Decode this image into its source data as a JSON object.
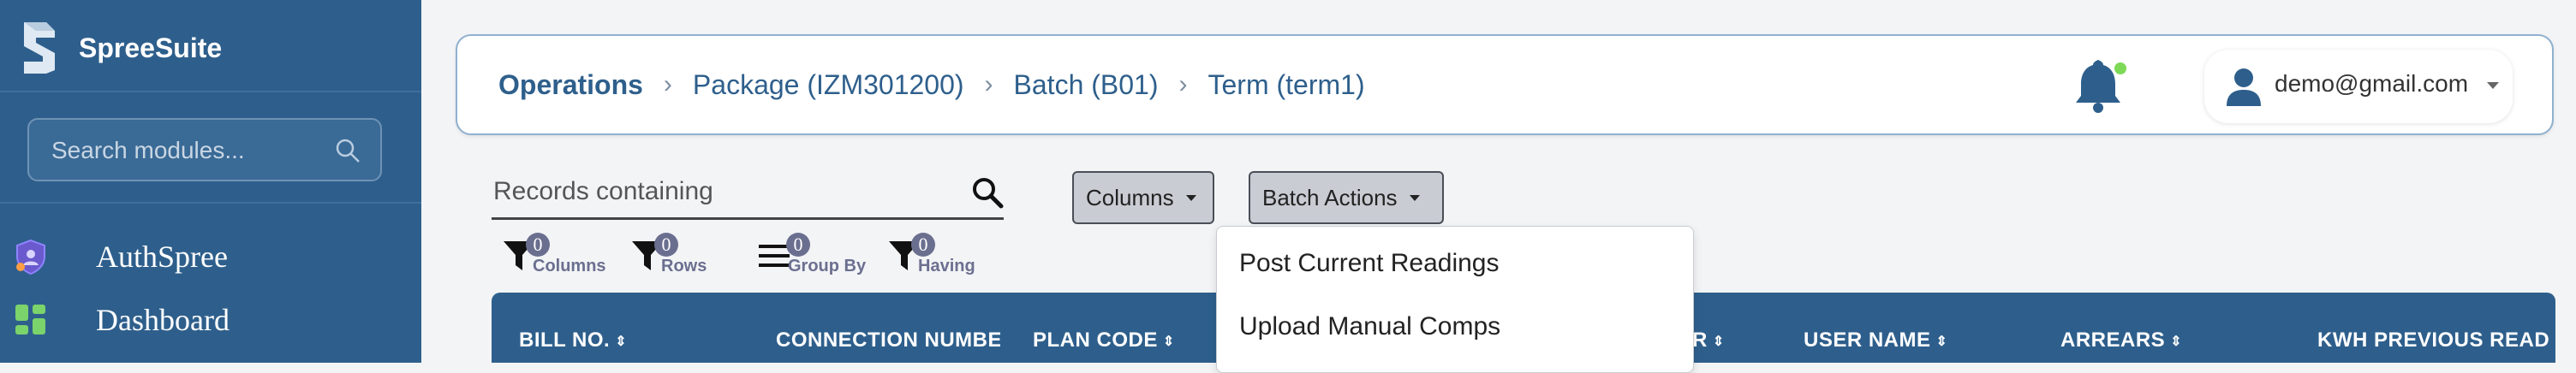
{
  "sidebar": {
    "brand_name": "SpreeSuite",
    "search_placeholder": "Search modules...",
    "items": [
      {
        "label": "AuthSpree",
        "icon": "shield-user-icon"
      },
      {
        "label": "Dashboard",
        "icon": "dashboard-grid-icon"
      }
    ]
  },
  "header": {
    "breadcrumbs": [
      "Operations",
      "Package (IZM301200)",
      "Batch (B01)",
      "Term (term1)"
    ],
    "user_email": "demo@gmail.com",
    "notification_icon": "bell-icon",
    "notification_dot_color": "#7ed957"
  },
  "toolbar": {
    "records_placeholder": "Records containing",
    "columns_label": "Columns",
    "batch_actions_label": "Batch Actions",
    "batch_actions_menu": [
      "Post Current Readings",
      "Upload Manual Comps"
    ],
    "filters": [
      {
        "label": "Columns",
        "count": "0",
        "icon": "funnel-icon"
      },
      {
        "label": "Rows",
        "count": "0",
        "icon": "funnel-icon"
      },
      {
        "label": "Group By",
        "count": "0",
        "icon": "list-icon"
      },
      {
        "label": "Having",
        "count": "0",
        "icon": "funnel-icon"
      }
    ]
  },
  "table": {
    "columns": [
      "BILL NO.",
      "CONNECTION NUMBER",
      "PLAN CODE",
      "R",
      "USER NAME",
      "ARREARS",
      "KWH PREVIOUS READ"
    ]
  },
  "colors": {
    "primary": "#2e5f8c",
    "sidebar_bg": "#2e5f8c",
    "badge": "#6b6f8f"
  }
}
